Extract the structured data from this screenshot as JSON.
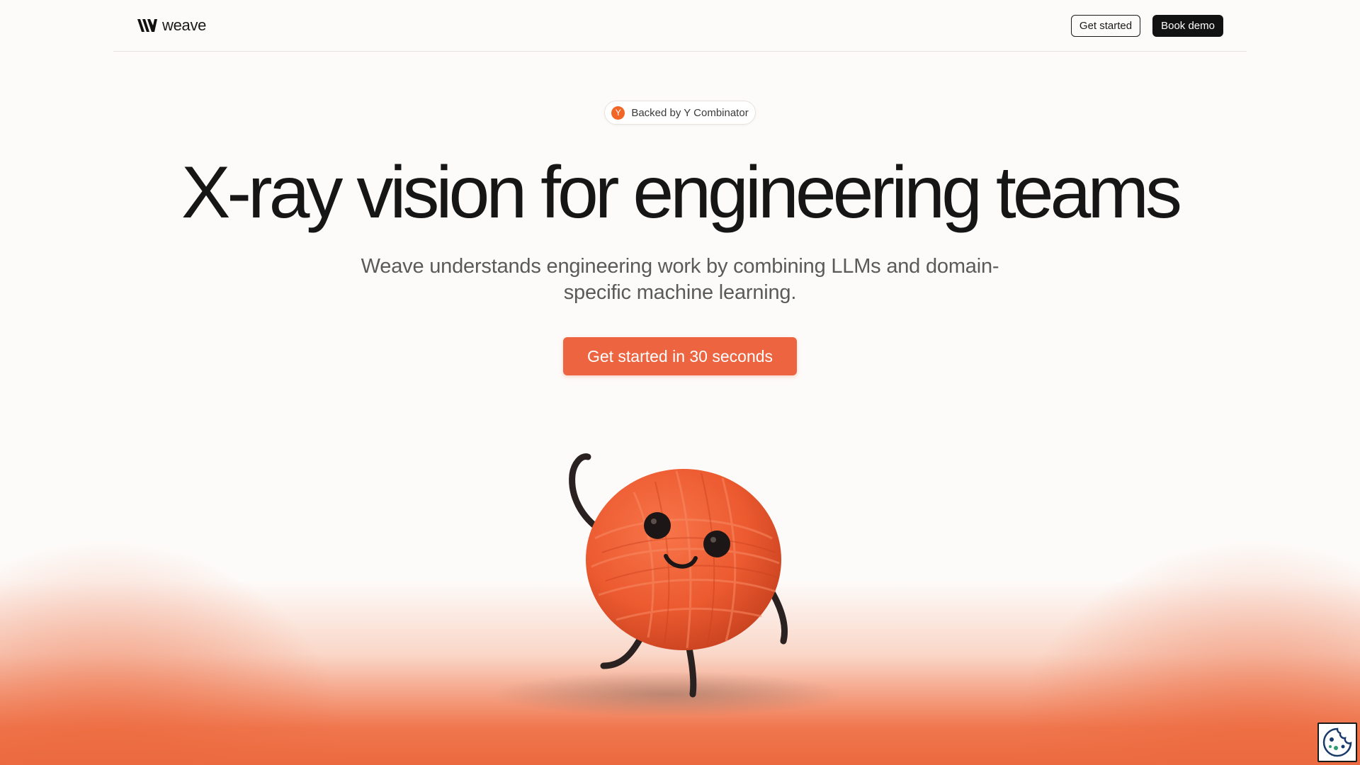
{
  "header": {
    "brand_name": "weave",
    "get_started_label": "Get started",
    "book_demo_label": "Book demo"
  },
  "hero": {
    "badge_icon_letter": "Y",
    "badge_text": "Backed by Y Combinator",
    "headline": "X-ray vision for engineering teams",
    "subline": "Weave understands engineering work by combining LLMs and domain-specific machine learning.",
    "cta_label": "Get started in 30 seconds"
  },
  "mascot": {
    "icon": "yarn-ball-mascot"
  },
  "cookie": {
    "icon": "cookie-icon"
  },
  "colors": {
    "accent": "#ec6440",
    "yc_orange": "#f26625",
    "dark_button": "#121212",
    "background": "#fdfbf9"
  }
}
